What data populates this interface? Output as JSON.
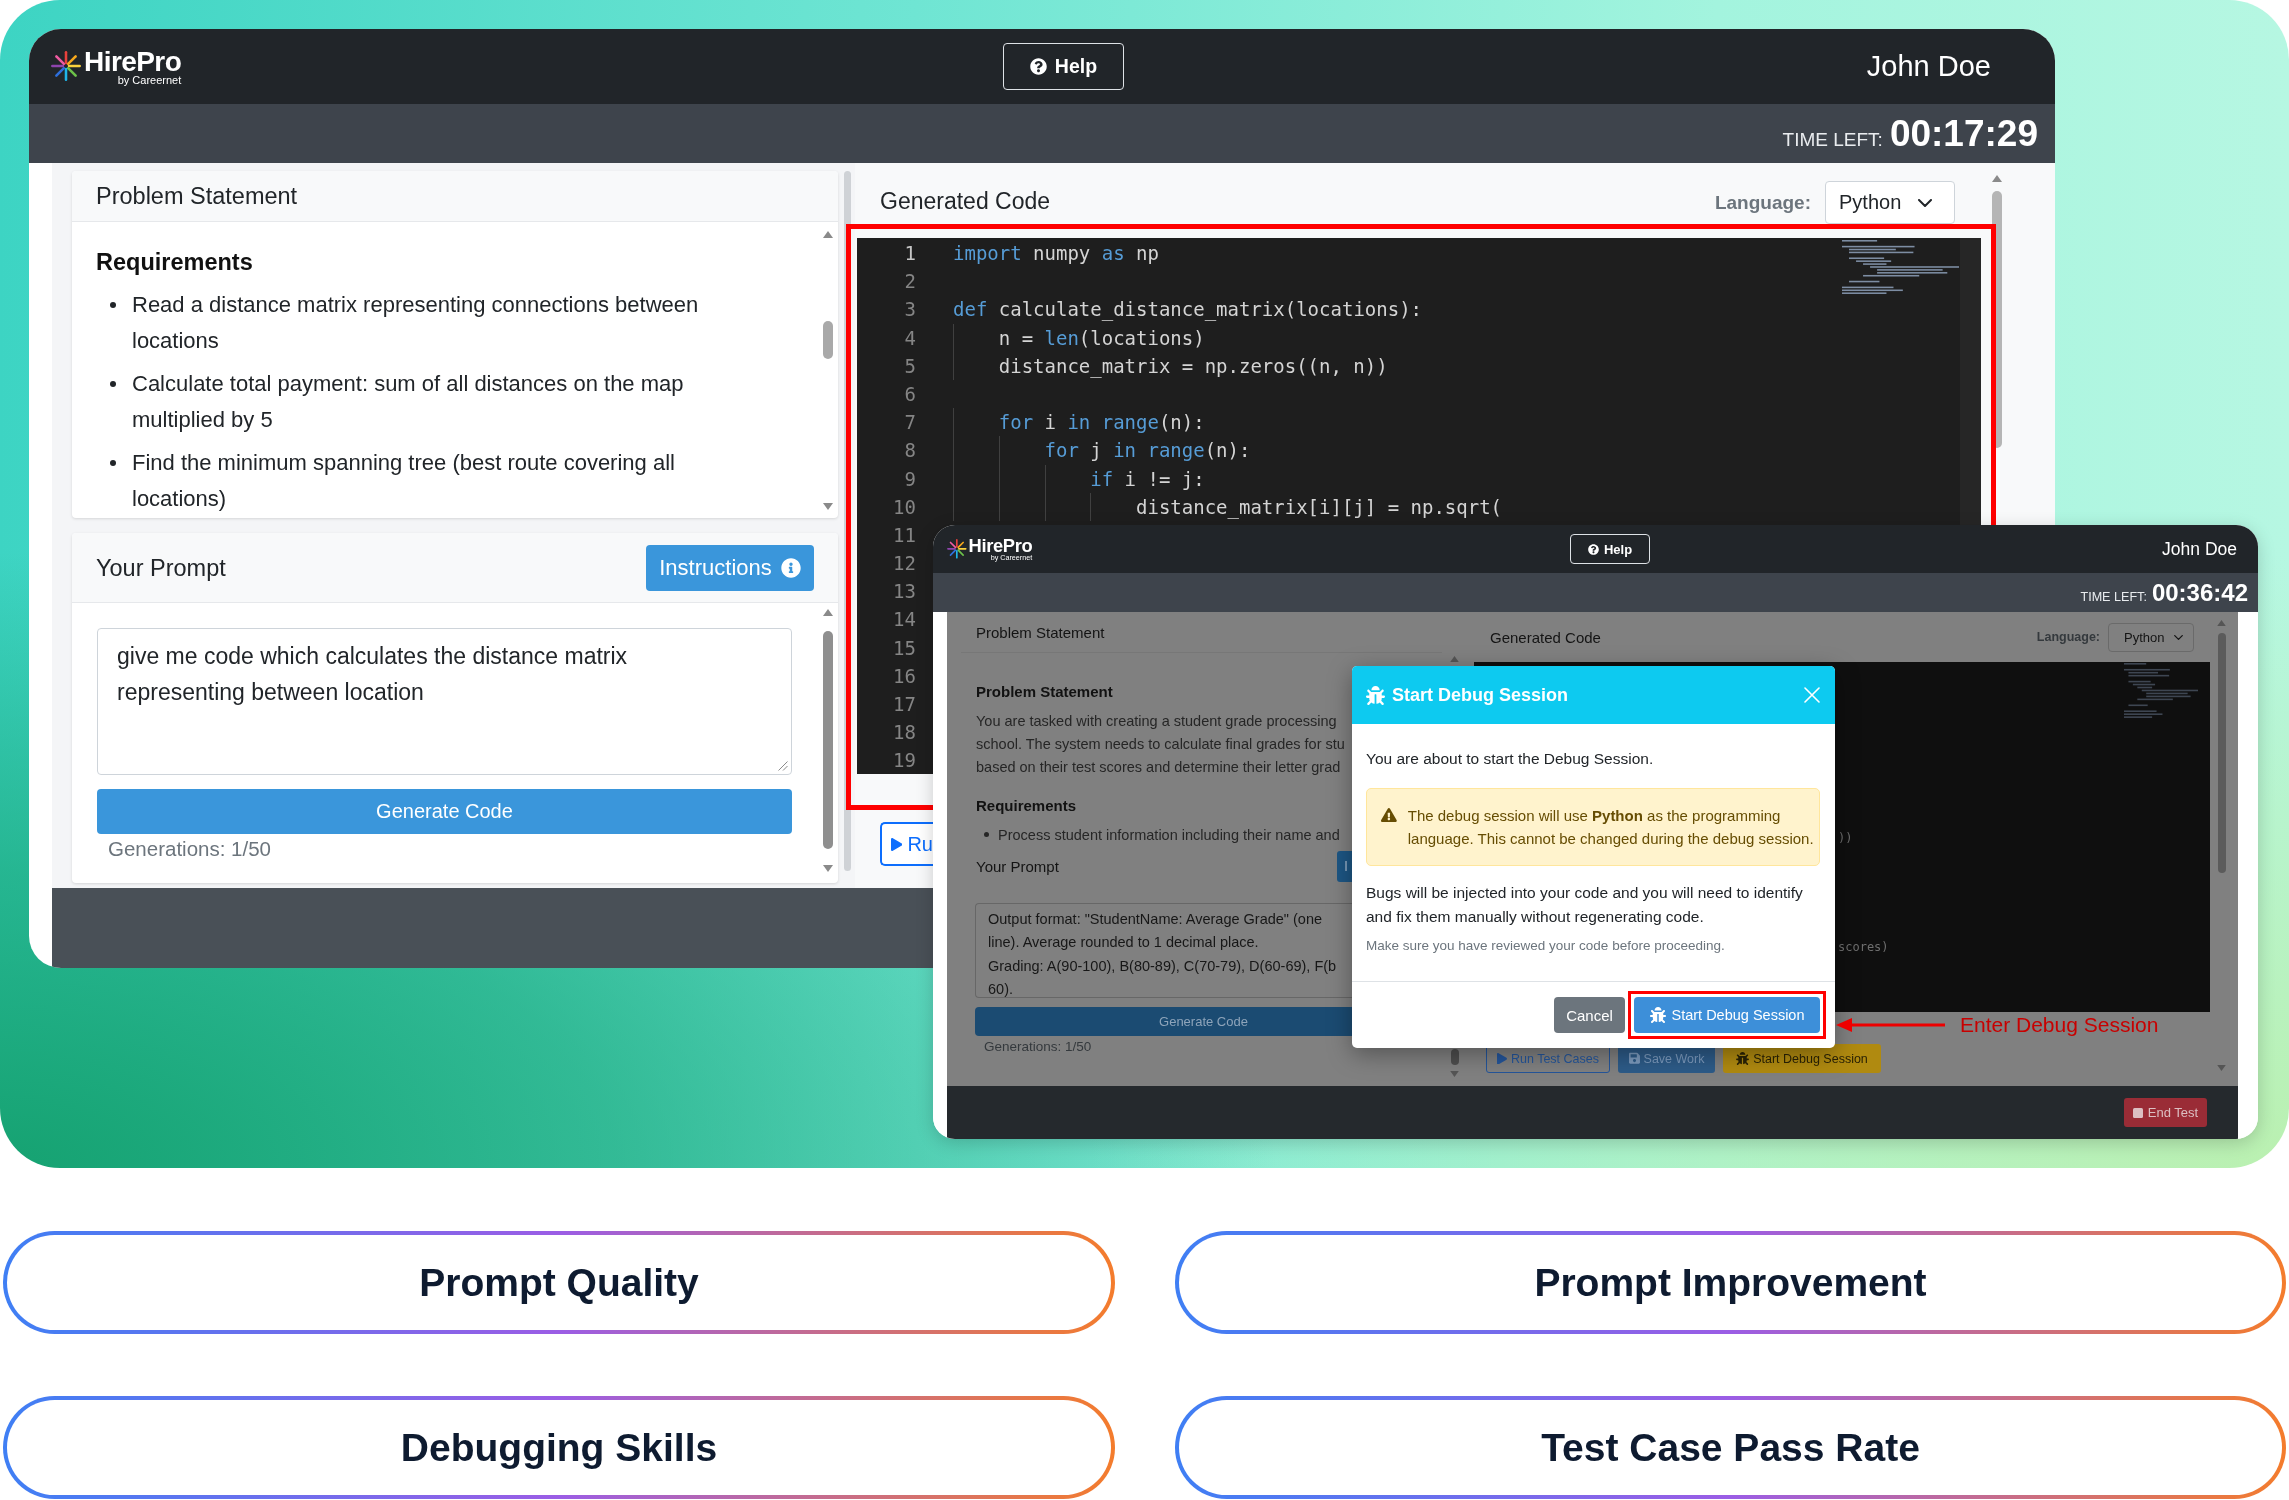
{
  "main_window": {
    "logo": {
      "name": "HirePro",
      "tagline": "by Careernet"
    },
    "help_button": "Help",
    "user_name": "John Doe",
    "timer": {
      "label": "TIME LEFT:",
      "value": "00:17:29"
    },
    "problem_panel": {
      "title": "Problem Statement",
      "heading": "Requirements",
      "bullets": [
        "Read a distance matrix representing connections between locations",
        "Calculate total payment: sum of all distances on the map multiplied by 5",
        "Find the minimum spanning tree (best route covering all locations)"
      ]
    },
    "prompt_panel": {
      "title": "Your Prompt",
      "instructions_button": "Instructions",
      "prompt": "give me code which calculates the distance matrix representing between location",
      "generate_button": "Generate Code",
      "generations": "Generations: 1/50"
    },
    "code_panel": {
      "title": "Generated Code",
      "language_label": "Language:",
      "language": "Python",
      "highlighted": true,
      "lines": [
        {
          "number": "1",
          "current": true,
          "tokens": [
            {
              "text": "import",
              "kind": "keyword"
            },
            {
              "text": " numpy ",
              "kind": "plain"
            },
            {
              "text": "as",
              "kind": "keyword"
            },
            {
              "text": " np",
              "kind": "plain"
            }
          ]
        },
        {
          "number": "2",
          "current": false
        },
        {
          "number": "3",
          "current": false,
          "tokens": [
            {
              "text": "def",
              "kind": "keyword"
            },
            {
              "text": " calculate_distance_matrix(locations):",
              "kind": "plain"
            }
          ]
        },
        {
          "number": "4",
          "current": false,
          "tokens": [
            {
              "text": "    n = ",
              "kind": "plain"
            },
            {
              "text": "len",
              "kind": "keyword"
            },
            {
              "text": "(locations)",
              "kind": "plain"
            }
          ]
        },
        {
          "number": "5",
          "current": false,
          "tokens": [
            {
              "text": "    distance_matrix = np.zeros((n, n))",
              "kind": "plain"
            }
          ]
        },
        {
          "number": "6",
          "current": false
        },
        {
          "number": "7",
          "current": false,
          "tokens": [
            {
              "text": "    for",
              "kind": "keyword"
            },
            {
              "text": " i ",
              "kind": "plain"
            },
            {
              "text": "in range",
              "kind": "keyword"
            },
            {
              "text": "(n):",
              "kind": "plain"
            }
          ]
        },
        {
          "number": "8",
          "current": false,
          "tokens": [
            {
              "text": "        for",
              "kind": "keyword"
            },
            {
              "text": " j ",
              "kind": "plain"
            },
            {
              "text": "in range",
              "kind": "keyword"
            },
            {
              "text": "(n):",
              "kind": "plain"
            }
          ]
        },
        {
          "number": "9",
          "current": false,
          "tokens": [
            {
              "text": "            if",
              "kind": "keyword"
            },
            {
              "text": " i != j:",
              "kind": "plain"
            }
          ]
        },
        {
          "number": "10",
          "current": false,
          "tokens": [
            {
              "text": "                distance_matrix[i][j] = np.sqrt(",
              "kind": "plain"
            }
          ]
        },
        {
          "number": "11",
          "current": false
        },
        {
          "number": "12",
          "current": false
        },
        {
          "number": "13",
          "current": false
        },
        {
          "number": "14",
          "current": false
        },
        {
          "number": "15",
          "current": false
        },
        {
          "number": "16",
          "current": false
        },
        {
          "number": "17",
          "current": false
        },
        {
          "number": "18",
          "current": false
        },
        {
          "number": "19",
          "current": false
        }
      ],
      "run_button": "Ru"
    }
  },
  "overlay_window": {
    "logo": {
      "name": "HirePro",
      "tagline": "by Careernet"
    },
    "help_button": "Help",
    "user_name": "John Doe",
    "timer": {
      "label": "TIME LEFT:",
      "value": "00:36:42"
    },
    "problem_panel": {
      "title": "Problem Statement",
      "heading": "Problem Statement",
      "paragraph": [
        "You are tasked with creating a student grade processing",
        "school. The system needs to calculate final grades for stu",
        "based on their test scores and determine their letter grad"
      ],
      "requirements_heading": "Requirements",
      "bullets": [
        "Process student information including their name and"
      ]
    },
    "prompt_panel": {
      "title": "Your Prompt",
      "instructions_button": "I",
      "prompt": [
        "Output format: \"StudentName: Average Grade\" (one",
        "line). Average rounded to 1 decimal place.",
        "Grading: A(90-100), B(80-89), C(70-79), D(60-69), F(b",
        "60)."
      ],
      "generate_button": "Generate Code",
      "generations": "Generations: 1/50"
    },
    "code_panel": {
      "title": "Generated Code",
      "language_label": "Language:",
      "language": "Python",
      "visible_code": [
        "))",
        "scores)"
      ],
      "buttons": [
        {
          "label": "Run Test Cases",
          "kind": "run"
        },
        {
          "label": "Save Work",
          "kind": "save"
        },
        {
          "label": "Start Debug Session",
          "kind": "debug"
        }
      ]
    },
    "end_test_button": "End Test",
    "modal": {
      "title": "Start Debug Session",
      "intro": "You are about to start the Debug Session.",
      "warning": "The debug session will use **Python** as the programming language. This cannot be changed during the debug session.",
      "body": "Bugs will be injected into your code and you will need to identify and fix them manually without regenerating code.",
      "note": "Make sure you have reviewed your code before proceeding.",
      "buttons": [
        {
          "label": "Cancel",
          "kind": "cancel",
          "highlighted": false
        },
        {
          "label": "Start Debug Session",
          "kind": "confirm",
          "highlighted": true
        }
      ]
    }
  },
  "annotation": "Enter Debug Session",
  "skills": [
    "Prompt Quality",
    "Prompt Improvement",
    "Debugging Skills",
    "Test Case Pass Rate"
  ]
}
